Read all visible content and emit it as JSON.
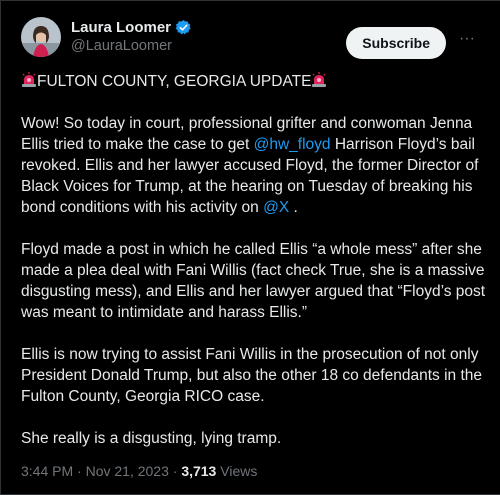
{
  "author": {
    "name": "Laura Loomer",
    "handle": "@LauraLoomer"
  },
  "header": {
    "subscribe_label": "Subscribe",
    "more_label": "···"
  },
  "post": {
    "headline": "FULTON COUNTY, GEORGIA UPDATE",
    "p1_a": "Wow! So today in court, professional grifter and conwoman Jenna Ellis tried to make the case to get ",
    "p1_mention": "@hw_floyd",
    "p1_b": " Harrison Floyd’s bail revoked. Ellis and her lawyer accused Floyd, the former Director of Black Voices for Trump, at the hearing on Tuesday of breaking his bond conditions with his activity on ",
    "p1_mention2": "@X",
    "p1_c": " .",
    "p2": "Floyd made a post in which he called Ellis “a whole mess” after she made a plea deal with Fani Willis (fact check True, she is a massive disgusting mess), and Ellis and her lawyer argued that “Floyd’s post was meant to intimidate and harass Ellis.”",
    "p3": "Ellis is now trying to assist Fani Willis in the prosecution of not only President Donald Trump, but also the other 18 co defendants in the Fulton County, Georgia RICO case.",
    "p4": "She really is a disgusting, lying tramp."
  },
  "meta": {
    "timestamp": "3:44 PM · Nov 21, 2023 · ",
    "views_count": "3,713",
    "views_label": " Views"
  },
  "colors": {
    "background": "#000000",
    "link": "#1d9bf0",
    "verified": "#1d9bf0",
    "siren": "#e0245e"
  },
  "icons": [
    "verified-badge-icon",
    "siren-icon",
    "more-icon"
  ]
}
